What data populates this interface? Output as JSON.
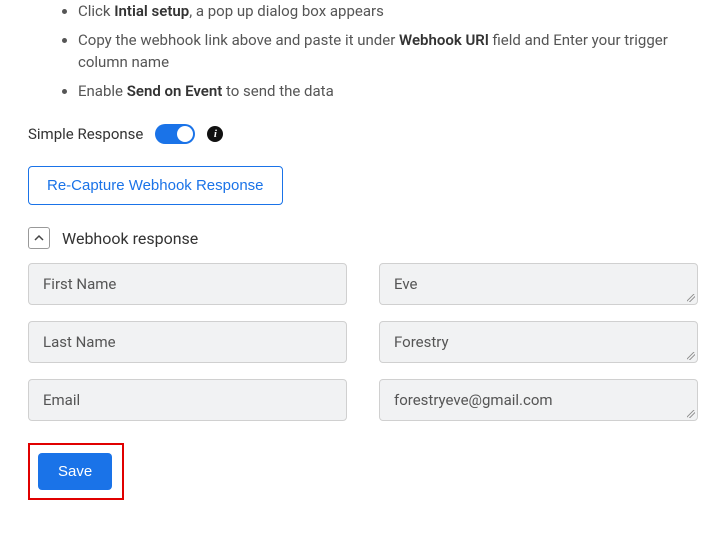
{
  "instructions": {
    "item1_prefix": "Click ",
    "item1_bold": "Intial setup",
    "item1_suffix": ", a pop up dialog box appears",
    "item2_prefix": "Copy the webhook link above and paste it under ",
    "item2_bold": "Webhook URl",
    "item2_suffix": " field and Enter your trigger column name",
    "item3_prefix": "Enable ",
    "item3_bold": "Send on Event",
    "item3_suffix": " to send the data"
  },
  "toggle": {
    "label": "Simple Response",
    "info_char": "i"
  },
  "buttons": {
    "recapture": "Re-Capture Webhook Response",
    "save": "Save"
  },
  "section": {
    "title": "Webhook response"
  },
  "fields": {
    "f1_label": "First Name",
    "f1_value": "Eve",
    "f2_label": "Last Name",
    "f2_value": "Forestry",
    "f3_label": "Email",
    "f3_value": "forestryeve@gmail.com"
  }
}
